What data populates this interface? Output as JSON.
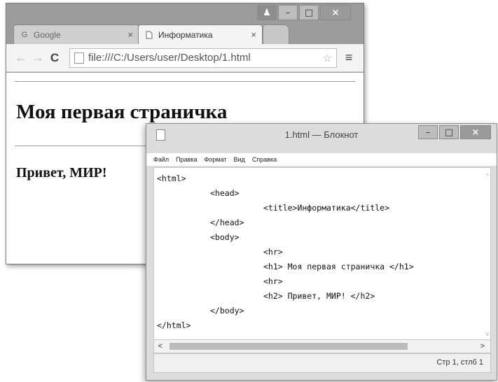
{
  "browser": {
    "window_buttons": {
      "user": "♟",
      "minimize": "–",
      "maximize": "□",
      "close": "×"
    },
    "tabs": [
      {
        "label": "Google",
        "icon": "google-icon",
        "close": "×"
      },
      {
        "label": "Информатика",
        "icon": "page-icon",
        "close": "×"
      }
    ],
    "toolbar": {
      "back": "←",
      "forward": "→",
      "reload": "C",
      "url": "file:///C:/Users/user/Desktop/1.html",
      "star": "☆",
      "menu": "≡"
    },
    "page": {
      "h1": "Моя первая страничка",
      "h2": "Привет, МИР!"
    }
  },
  "notepad": {
    "title": "1.html — Блокнот",
    "window_buttons": {
      "minimize": "–",
      "maximize": "□",
      "close": "×"
    },
    "menu": [
      "Файл",
      "Правка",
      "Формат",
      "Вид",
      "Справка"
    ],
    "code_lines": [
      "<html>",
      "<head>",
      "<title>Информатика</title>",
      "</head>",
      "<body>",
      "<hr>",
      "<h1> Моя первая страничка </h1>",
      "<hr>",
      "<h2> Привет, МИР! </h2>",
      "</body>",
      "</html>"
    ],
    "scroll": {
      "up": "^",
      "down": "v",
      "left": "<",
      "right": ">"
    },
    "status": "Стр 1, стлб 1"
  },
  "colors": {
    "chrome_frame": "#9c9c9c",
    "toolbar_bg": "#f4f4f4",
    "notepad_frame": "#dcdcdc",
    "text": "#111111"
  }
}
